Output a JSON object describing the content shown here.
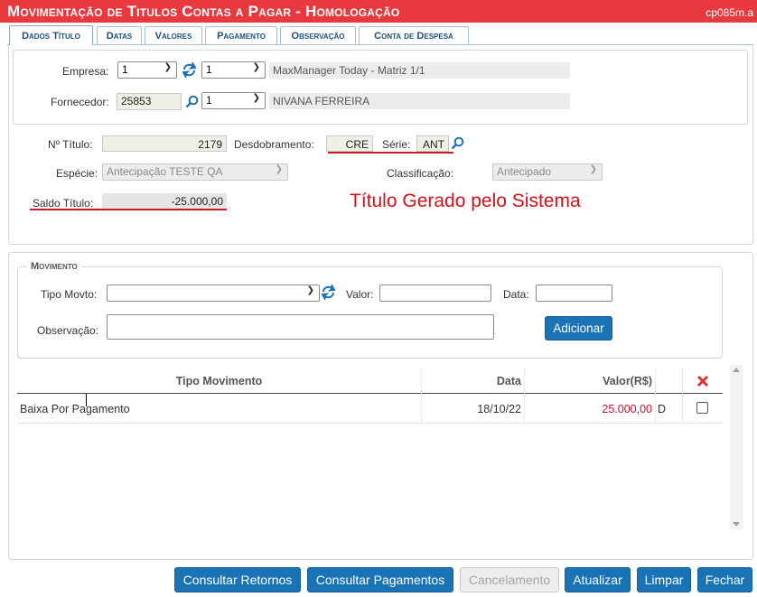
{
  "window": {
    "title": "Movimentação de Titulos Contas a Pagar  - Homologação",
    "code": "cp085m.a"
  },
  "tabs": [
    {
      "label": "Dados Título",
      "active": true
    },
    {
      "label": "Datas"
    },
    {
      "label": "Valores"
    },
    {
      "label": "Pagamento"
    },
    {
      "label": "Observação"
    },
    {
      "label": "Conta de Despesa"
    }
  ],
  "header": {
    "empresa_label": "Empresa:",
    "empresa_value": "1",
    "empresa_filial": "1",
    "empresa_desc": "MaxManager Today - Matriz 1/1",
    "fornecedor_label": "Fornecedor:",
    "fornecedor_value": "25853",
    "fornecedor_seq": "1",
    "fornecedor_desc": "NIVANA FERREIRA"
  },
  "titulo": {
    "numero_label": "Nº Título:",
    "numero_value": "2179",
    "desdobramento_label": "Desdobramento:",
    "desdobramento_value": "CRE",
    "serie_label": "Série:",
    "serie_value": "ANT",
    "especie_label": "Espécie:",
    "especie_value": "Antecipação TESTE QA",
    "classificacao_label": "Classificação:",
    "classificacao_value": "Antecipado",
    "saldo_label": "Saldo Título:",
    "saldo_value": "-25.000,00",
    "annotation": "Título Gerado pelo Sistema"
  },
  "movimento": {
    "legend": "Movimento",
    "tipo_label": "Tipo Movto:",
    "tipo_value": "",
    "valor_label": "Valor:",
    "valor_value": "",
    "data_label": "Data:",
    "data_value": "",
    "obs_label": "Observação:",
    "obs_value": "",
    "add_button": "Adicionar"
  },
  "grid": {
    "columns": [
      "Tipo Movimento",
      "Data",
      "Valor(R$)",
      ""
    ],
    "rows": [
      {
        "tipo": "Baixa Por Pagamento",
        "data": "18/10/22",
        "valor": "25.000,00",
        "dc": "D",
        "checked": false
      }
    ]
  },
  "footer": {
    "consultar_retornos": "Consultar Retornos",
    "consultar_pagamentos": "Consultar Pagamentos",
    "cancelamento": "Cancelamento",
    "atualizar": "Atualizar",
    "limpar": "Limpar",
    "fechar": "Fechar"
  },
  "colors": {
    "titlebar": "#e8393f",
    "primary_button": "#1a73b5",
    "annotation_red": "#d1121a",
    "value_red": "#c8102e"
  }
}
